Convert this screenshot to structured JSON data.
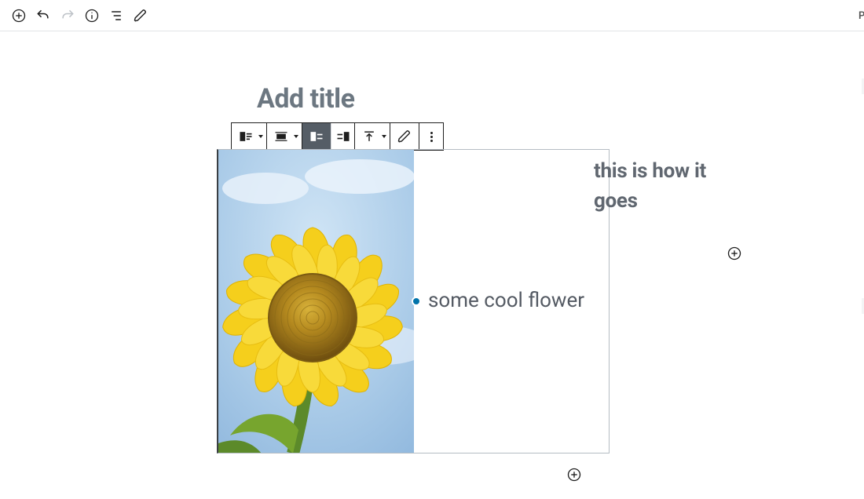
{
  "top_toolbar": {
    "add": {
      "name": "add-block-button"
    },
    "undo": {
      "name": "undo-button"
    },
    "redo": {
      "name": "redo-button",
      "disabled": true
    },
    "info": {
      "name": "content-structure-button"
    },
    "outline": {
      "name": "block-navigation-button"
    },
    "edit": {
      "name": "tools-edit-button"
    },
    "right_peek_char": "P"
  },
  "post": {
    "title_placeholder": "Add title"
  },
  "block_toolbar": {
    "items": [
      {
        "name": "change-block-type-button",
        "icon": "media-text",
        "caret": true
      },
      {
        "name": "change-alignment-button",
        "icon": "align",
        "caret": true
      },
      {
        "name": "media-left-button",
        "icon": "media-left",
        "active": true
      },
      {
        "name": "media-right-button",
        "icon": "media-right"
      },
      {
        "name": "vertical-align-button",
        "icon": "valign-top",
        "caret": true
      },
      {
        "name": "edit-media-button",
        "icon": "pencil"
      },
      {
        "name": "more-options-button",
        "icon": "more"
      }
    ]
  },
  "media_text_block": {
    "image_alt": "sunflower",
    "caption": "some cool flower"
  },
  "right_column": {
    "heading": "this is how it goes"
  },
  "add_buttons": {
    "right": {
      "name": "add-block-right-button"
    },
    "bottom": {
      "name": "add-block-below-button"
    }
  }
}
